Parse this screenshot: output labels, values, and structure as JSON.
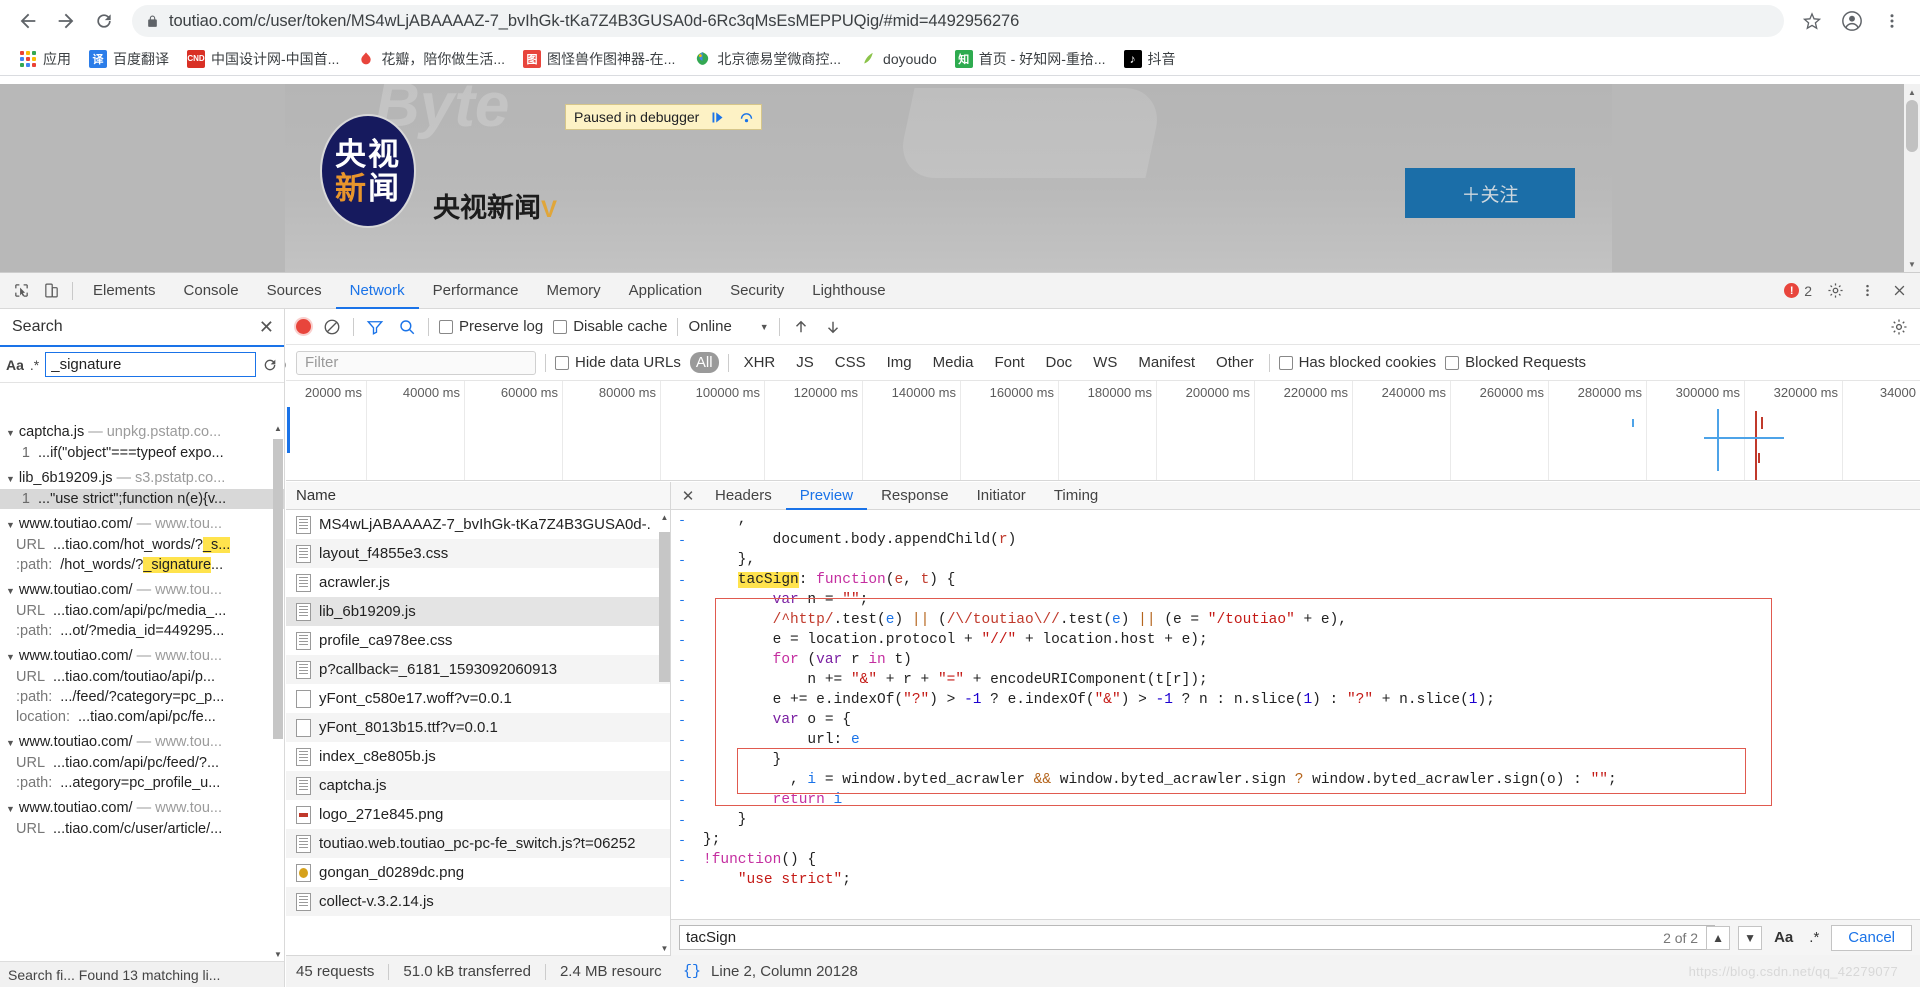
{
  "browser": {
    "url": "toutiao.com/c/user/token/MS4wLjABAAAAZ-7_bvIhGk-tKa7Z4B3GUSA0d-6Rc3qMsEsMEPPUQig/#mid=4492956276",
    "back_icon": "back-arrow-icon",
    "forward_icon": "forward-arrow-icon",
    "reload_icon": "reload-icon",
    "lock_icon": "lock-icon",
    "star_icon": "star-icon",
    "profile_icon": "profile-avatar-icon",
    "menu_icon": "three-dot-menu-icon",
    "bookmarks": [
      {
        "label": "应用",
        "icon": "apps-grid-icon",
        "color": "#4285f4"
      },
      {
        "label": "百度翻译",
        "icon": "translate-icon",
        "color": "#2b7de9",
        "glyph": "译"
      },
      {
        "label": "中国设计网-中国首...",
        "icon": "cnd-icon",
        "color": "#d93025",
        "glyph": "CND"
      },
      {
        "label": "花瓣，陪你做生活...",
        "icon": "huaban-icon",
        "color": "#e8453c",
        "glyph": ""
      },
      {
        "label": "图怪兽作图神器-在...",
        "icon": "tuguaishou-icon",
        "color": "#e8453c",
        "glyph": "图"
      },
      {
        "label": "北京德易堂微商控...",
        "icon": "deyitang-icon",
        "color": "#34a853",
        "glyph": ""
      },
      {
        "label": "doyoudo",
        "icon": "doyoudo-icon",
        "color": "#8bc34a",
        "glyph": ""
      },
      {
        "label": "首页 - 好知网-重拾...",
        "icon": "haozhi-icon",
        "color": "#2eab4f",
        "glyph": "知"
      },
      {
        "label": "抖音",
        "icon": "douyin-icon",
        "color": "#000000",
        "glyph": "♪"
      }
    ]
  },
  "page": {
    "watermark_text": "Byte",
    "avatar_line1": "央视",
    "avatar_line2_orange": "新",
    "avatar_line2_white": "闻",
    "account_name": "央视新闻",
    "account_badge": "V",
    "follow_button": "＋关注",
    "paused_banner": {
      "text": "Paused in debugger",
      "resume_icon": "resume-script-icon",
      "step_over_icon": "step-over-icon"
    },
    "collapse_icon": "chevron-up-icon"
  },
  "devtools": {
    "inspect_icon": "inspect-element-icon",
    "device_icon": "device-toolbar-icon",
    "tabs": [
      "Elements",
      "Console",
      "Sources",
      "Network",
      "Performance",
      "Memory",
      "Application",
      "Security",
      "Lighthouse"
    ],
    "active_tab": "Network",
    "error_count": "2",
    "settings_icon": "gear-icon",
    "more_icon": "three-dot-menu-icon",
    "close_icon": "close-icon",
    "right_gear_icon": "gear-icon"
  },
  "search_pane": {
    "title": "Search",
    "close_icon": "close-icon",
    "match_case_label": "Aa",
    "regex_label": ".*",
    "query": "_signature",
    "refresh_icon": "refresh-icon",
    "clear_icon": "clear-icon",
    "status": "Search fi... Found 13 matching li...",
    "results": [
      {
        "file": "captcha.js",
        "origin": "— unpkg.pstatp.co...",
        "lines": [
          {
            "num": "1",
            "text": "...if(\"object\"===typeof expo...",
            "selected": false
          }
        ]
      },
      {
        "file": "lib_6b19209.js",
        "origin": "— s3.pstatp.co...",
        "lines": [
          {
            "num": "1",
            "text": "...\"use strict\";function n(e){v...",
            "selected": true
          }
        ]
      },
      {
        "file": "www.toutiao.com/",
        "origin": "— www.tou...",
        "fields": [
          {
            "key": "URL",
            "pre": "...tiao.com/hot_words/?",
            "hl": "_s...",
            "post": ""
          },
          {
            "key": ":path:",
            "pre": "/hot_words/?",
            "hl": "_signature",
            "post": "..."
          }
        ]
      },
      {
        "file": "www.toutiao.com/",
        "origin": "— www.tou...",
        "fields": [
          {
            "key": "URL",
            "pre": "...tiao.com/api/pc/media_...",
            "hl": "",
            "post": ""
          },
          {
            "key": ":path:",
            "pre": "...ot/?media_id=449295...",
            "hl": "",
            "post": ""
          }
        ]
      },
      {
        "file": "www.toutiao.com/",
        "origin": "— www.tou...",
        "fields": [
          {
            "key": "URL",
            "pre": "...tiao.com/toutiao/api/p...",
            "hl": "",
            "post": ""
          },
          {
            "key": ":path:",
            "pre": ".../feed/?category=pc_p...",
            "hl": "",
            "post": ""
          },
          {
            "key": "location:",
            "pre": "...tiao.com/api/pc/fe...",
            "hl": "",
            "post": ""
          }
        ]
      },
      {
        "file": "www.toutiao.com/",
        "origin": "— www.tou...",
        "fields": [
          {
            "key": "URL",
            "pre": "...tiao.com/api/pc/feed/?...",
            "hl": "",
            "post": ""
          },
          {
            "key": ":path:",
            "pre": "...ategory=pc_profile_u...",
            "hl": "",
            "post": ""
          }
        ]
      },
      {
        "file": "www.toutiao.com/",
        "origin": "— www.tou...",
        "fields": [
          {
            "key": "URL",
            "pre": "...tiao.com/c/user/article/...",
            "hl": "",
            "post": ""
          }
        ]
      }
    ]
  },
  "network": {
    "record_icon": "record-stop-icon",
    "clear_icon": "clear-icon",
    "filter_icon": "filter-funnel-icon",
    "search_icon": "search-icon",
    "preserve_log": "Preserve log",
    "disable_cache": "Disable cache",
    "throttle_value": "Online",
    "import_icon": "import-har-icon",
    "export_icon": "export-har-icon",
    "filter_placeholder": "Filter",
    "hide_data_urls": "Hide data URLs",
    "type_filters": [
      "All",
      "XHR",
      "JS",
      "CSS",
      "Img",
      "Media",
      "Font",
      "Doc",
      "WS",
      "Manifest",
      "Other"
    ],
    "active_type_filter": "All",
    "has_blocked_cookies": "Has blocked cookies",
    "blocked_requests": "Blocked Requests",
    "timeline_ticks": [
      "20000 ms",
      "40000 ms",
      "60000 ms",
      "80000 ms",
      "100000 ms",
      "120000 ms",
      "140000 ms",
      "160000 ms",
      "180000 ms",
      "200000 ms",
      "220000 ms",
      "240000 ms",
      "260000 ms",
      "280000 ms",
      "300000 ms",
      "320000 ms",
      "34000"
    ],
    "name_column": "Name",
    "requests": [
      {
        "name": "MS4wLjABAAAAZ-7_bvIhGk-tKa7Z4B3GUSA0d-.",
        "icon": "doc",
        "selected": false
      },
      {
        "name": "layout_f4855e3.css",
        "icon": "doc",
        "selected": false
      },
      {
        "name": "acrawler.js",
        "icon": "doc",
        "selected": false
      },
      {
        "name": "lib_6b19209.js",
        "icon": "doc",
        "selected": true
      },
      {
        "name": "profile_ca978ee.css",
        "icon": "doc",
        "selected": false
      },
      {
        "name": "p?callback=_6181_1593092060913",
        "icon": "doc",
        "selected": false
      },
      {
        "name": "yFont_c580e17.woff?v=0.0.1",
        "icon": "blank",
        "selected": false
      },
      {
        "name": "yFont_8013b15.ttf?v=0.0.1",
        "icon": "blank",
        "selected": false
      },
      {
        "name": "index_c8e805b.js",
        "icon": "doc",
        "selected": false
      },
      {
        "name": "captcha.js",
        "icon": "doc",
        "selected": false
      },
      {
        "name": "logo_271e845.png",
        "icon": "img-red",
        "selected": false
      },
      {
        "name": "toutiao.web.toutiao_pc-pc-fe_switch.js?t=06252",
        "icon": "doc",
        "selected": false
      },
      {
        "name": "gongan_d0289dc.png",
        "icon": "img-gold",
        "selected": false
      },
      {
        "name": "collect-v.3.2.14.js",
        "icon": "doc",
        "selected": false
      }
    ],
    "status": {
      "requests": "45 requests",
      "transferred": "51.0 kB transferred",
      "resources": "2.4 MB resourc"
    }
  },
  "detail": {
    "close_icon": "close-icon",
    "tabs": [
      "Headers",
      "Preview",
      "Response",
      "Initiator",
      "Timing"
    ],
    "active_tab": "Preview",
    "code_lines": [
      ",",
      "        document.body.appendChild(r)",
      "    },",
      "    tacSign: function(e, t) {",
      "        var n = \"\";",
      "        /^http/.test(e) || (/\\/toutiao\\//.test(e) || (e = \"/toutiao\" + e),",
      "        e = location.protocol + \"//\" + location.host + e);",
      "        for (var r in t)",
      "            n += \"&\" + r + \"=\" + encodeURIComponent(t[r]);",
      "        e += e.indexOf(\"?\") > -1 ? e.indexOf(\"&\") > -1 ? n : n.slice(1) : \"?\" + n.slice(1);",
      "        var o = {",
      "            url: e",
      "        }",
      "          , i = window.byted_acrawler && window.byted_acrawler.sign ? window.byted_acrawler.sign(o) : \"\";",
      "        return i",
      "    }",
      "};",
      "!function() {",
      "    \"use strict\";"
    ],
    "highlight_token": "tacSign"
  },
  "find": {
    "query": "tacSign",
    "count": "2 of 2",
    "prev_icon": "chevron-up-icon",
    "next_icon": "chevron-down-icon",
    "match_case_label": "Aa",
    "regex_label": ".*",
    "cancel_label": "Cancel"
  },
  "code_status": {
    "format_icon": "pretty-print-braces-icon",
    "position": "Line 2, Column 20128"
  },
  "watermark": "https://blog.csdn.net/qq_42279077"
}
